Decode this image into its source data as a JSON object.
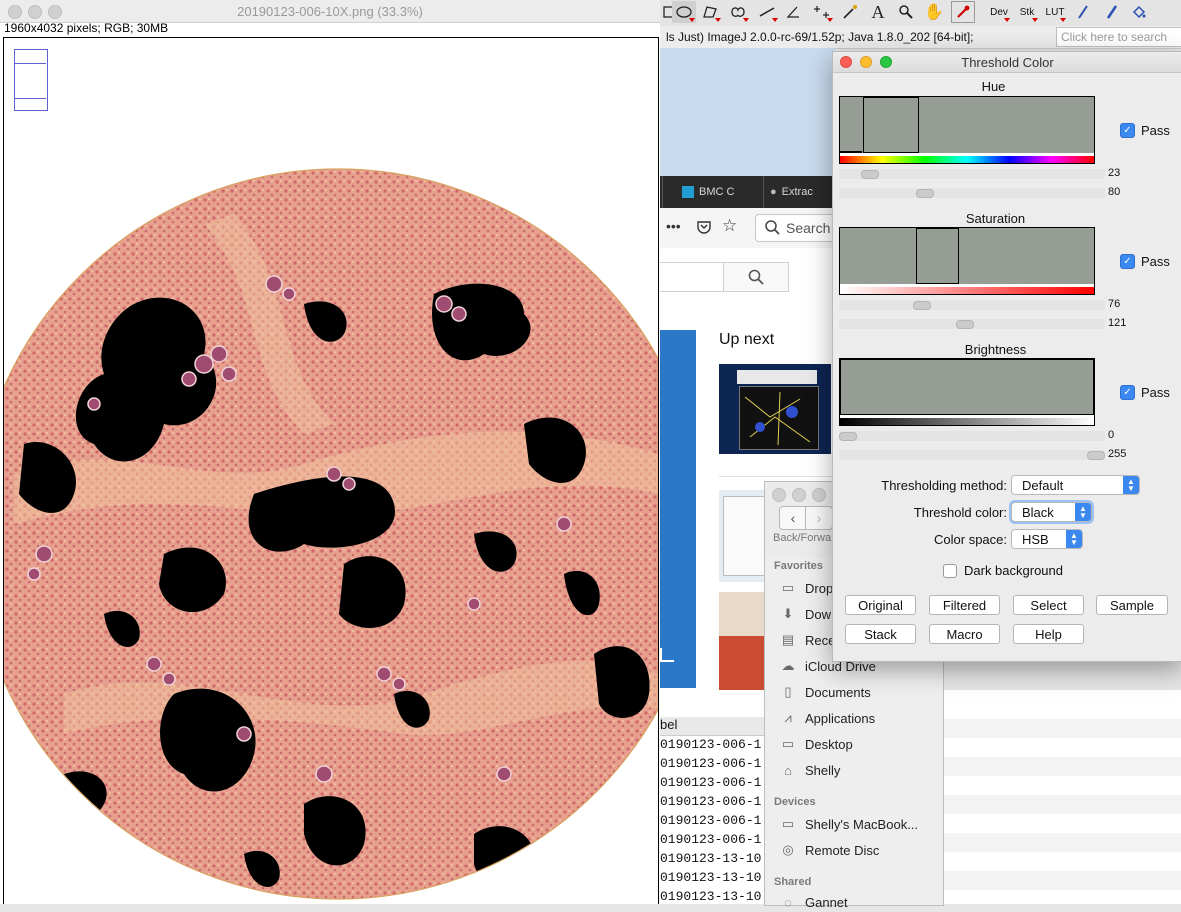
{
  "image_window": {
    "title": "20190123-006-10X.png (33.3%)",
    "info": "1960x4032 pixels; RGB; 30MB"
  },
  "toolbar": {
    "tools": [
      "rectangle-icon",
      "oval-icon",
      "polygon-icon",
      "freehand-icon",
      "line-icon",
      "angle-icon",
      "multipoint-icon",
      "wand-icon",
      "text-icon",
      "magnifier-icon",
      "hand-icon",
      "dropper-icon"
    ],
    "dev_label": "Dev",
    "stk_label": "Stk",
    "lut_label": "LUT"
  },
  "status": {
    "text": "ls Just) ImageJ 2.0.0-rc-69/1.52p; Java 1.8.0_202 [64-bit];",
    "search_placeholder": "Click here to search"
  },
  "browser": {
    "tabs": [
      "BMC C",
      "Extrac"
    ],
    "search_placeholder": "Search",
    "up_next": "Up next"
  },
  "results_table": {
    "header": "bel",
    "rows": [
      "0190123-006-1",
      "0190123-006-1",
      "0190123-006-1",
      "0190123-006-1",
      "0190123-006-1",
      "0190123-006-1",
      "0190123-13-10",
      "0190123-13-10",
      "0190123-13-10"
    ]
  },
  "finder": {
    "back_forward": "Back/Forwa",
    "favorites_label": "Favorites",
    "favorites": [
      "Drop",
      "Dow",
      "Rece",
      "iCloud Drive",
      "Documents",
      "Applications",
      "Desktop",
      "Shelly"
    ],
    "devices_label": "Devices",
    "devices": [
      "Shelly's MacBook...",
      "Remote Disc"
    ],
    "shared_label": "Shared",
    "shared": [
      "Gannet"
    ]
  },
  "threshold": {
    "title": "Threshold Color",
    "pass_label": "Pass",
    "hue": {
      "label": "Hue",
      "min": "23",
      "max": "80",
      "min_frac": 0.09,
      "max_frac": 0.31
    },
    "saturation": {
      "label": "Saturation",
      "min": "76",
      "max": "121",
      "min_frac": 0.3,
      "max_frac": 0.47
    },
    "brightness": {
      "label": "Brightness",
      "min": "0",
      "max": "255",
      "min_frac": 0.0,
      "max_frac": 1.0
    },
    "method_label": "Thresholding method:",
    "method_value": "Default",
    "color_label": "Threshold color:",
    "color_value": "Black",
    "space_label": "Color space:",
    "space_value": "HSB",
    "dark_bg_label": "Dark background",
    "buttons": [
      "Original",
      "Filtered",
      "Select",
      "Sample",
      "Stack",
      "Macro",
      "Help"
    ]
  },
  "colors": {
    "accent": "#3a88f0",
    "histogram_gray": "#959d94",
    "tissue_pink": "#e39a8a",
    "stain_purple": "#a04b70",
    "threshold_black": "#000000"
  }
}
